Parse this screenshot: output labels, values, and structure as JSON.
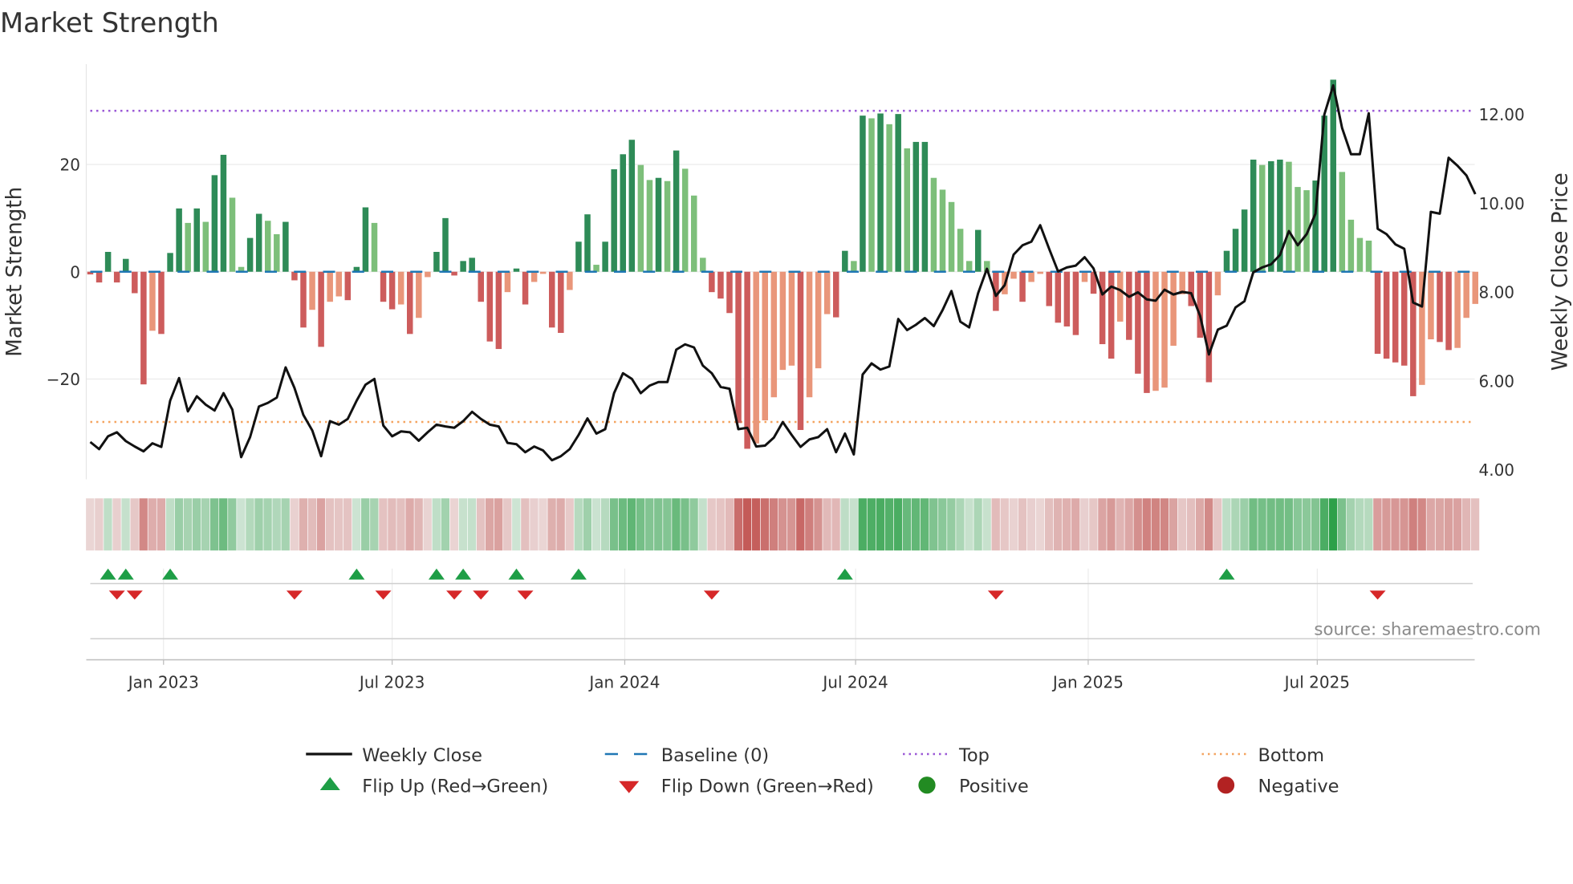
{
  "chart_data": {
    "type": "bar+line",
    "title": "Market Strength",
    "ylabel_left": "Market Strength",
    "ylabel_right": "Weekly Close Price",
    "left_ylim": [
      -38,
      39
    ],
    "right_ylim": [
      3.75,
      13.2
    ],
    "left_ticks": [
      {
        "v": 20,
        "label": "20"
      },
      {
        "v": 0,
        "label": "0"
      },
      {
        "v": -20,
        "label": "−20"
      }
    ],
    "right_ticks": [
      {
        "v": 12,
        "label": "12.00"
      },
      {
        "v": 10,
        "label": "10.00"
      },
      {
        "v": 8,
        "label": "8.00"
      },
      {
        "v": 6,
        "label": "6.00"
      },
      {
        "v": 4,
        "label": "4.00"
      }
    ],
    "x_unit": "week index (week 0 ≈ early Nov 2022)",
    "x_ticks": [
      {
        "label": "Jan 2023",
        "week": 8.25
      },
      {
        "label": "Jul 2023",
        "week": 34.0
      },
      {
        "label": "Jan 2024",
        "week": 60.2
      },
      {
        "label": "Jul 2024",
        "week": 86.2
      },
      {
        "label": "Jan 2025",
        "week": 112.4
      },
      {
        "label": "Jul 2025",
        "week": 138.2
      }
    ],
    "top_level": 30,
    "bottom_level": -28,
    "baseline": 0,
    "strength": [
      -0.5,
      -2,
      3.7,
      -2,
      2.4,
      -4,
      -21,
      -11,
      -11.6,
      3.5,
      11.8,
      9.1,
      11.8,
      9.3,
      18,
      21.8,
      13.8,
      0.9,
      6.3,
      10.8,
      9.5,
      7,
      9.3,
      -1.6,
      -10.4,
      -7.1,
      -14,
      -5.6,
      -4.6,
      -5.3,
      0.9,
      12,
      9.1,
      -5.6,
      -7,
      -6.1,
      -11.6,
      -8.6,
      -1,
      3.7,
      10,
      -0.7,
      2,
      2.6,
      -5.6,
      -13,
      -14.4,
      -3.8,
      0.6,
      -6.1,
      -1.9,
      -0.4,
      -10.4,
      -11.4,
      -3.4,
      5.6,
      10.7,
      1.3,
      5.6,
      19.1,
      21.9,
      24.6,
      19.9,
      17.1,
      17.5,
      16.9,
      22.6,
      19.2,
      14.2,
      2.6,
      -3.8,
      -5,
      -7.7,
      -28.2,
      -33,
      -32,
      -27.7,
      -23.4,
      -18.3,
      -17.5,
      -29.5,
      -23.4,
      -18,
      -7.9,
      -8.5,
      3.9,
      2,
      29.1,
      28.6,
      29.5,
      27.5,
      29.4,
      23,
      24.2,
      24.2,
      17.5,
      15.3,
      13,
      8,
      2,
      7.8,
      2,
      -7.3,
      -4.2,
      -1.3,
      -5.6,
      -1.9,
      -0.4,
      -6.4,
      -9.5,
      -10.2,
      -11.8,
      -1.9,
      -4.1,
      -13.5,
      -16.2,
      -9.3,
      -12.7,
      -19,
      -22.6,
      -22.2,
      -21.6,
      -13.8,
      -4.2,
      -6.4,
      -12.3,
      -20.6,
      -4.4,
      3.9,
      8,
      11.6,
      20.9,
      19.9,
      20.6,
      20.9,
      20.5,
      15.8,
      15.2,
      17,
      29.1,
      35.8,
      18.6,
      9.7,
      6.3,
      5.8,
      -15.3,
      -16.2,
      -16.9,
      -17.5,
      -23.2,
      -21.1,
      -12.6,
      -13.1,
      -14.6,
      -14.2,
      -8.6,
      -6
    ],
    "weekly_close": [
      4.6,
      4.44,
      4.73,
      4.82,
      4.62,
      4.5,
      4.39,
      4.57,
      4.49,
      5.53,
      6.04,
      5.29,
      5.63,
      5.44,
      5.31,
      5.7,
      5.33,
      4.26,
      4.71,
      5.4,
      5.48,
      5.6,
      6.28,
      5.82,
      5.21,
      4.86,
      4.28,
      5.07,
      4.99,
      5.12,
      5.53,
      5.89,
      6.02,
      4.97,
      4.73,
      4.84,
      4.82,
      4.63,
      4.82,
      4.99,
      4.95,
      4.92,
      5.07,
      5.28,
      5.12,
      4.99,
      4.95,
      4.58,
      4.55,
      4.37,
      4.5,
      4.41,
      4.19,
      4.28,
      4.44,
      4.76,
      5.13,
      4.79,
      4.89,
      5.7,
      6.15,
      6.02,
      5.7,
      5.87,
      5.95,
      5.95,
      6.68,
      6.8,
      6.73,
      6.32,
      6.15,
      5.84,
      5.8,
      4.89,
      4.92,
      4.5,
      4.52,
      4.7,
      5.05,
      4.76,
      4.49,
      4.66,
      4.71,
      4.89,
      4.37,
      4.79,
      4.32,
      6.12,
      6.37,
      6.23,
      6.3,
      7.37,
      7.12,
      7.24,
      7.39,
      7.21,
      7.57,
      8.0,
      7.31,
      7.18,
      7.95,
      8.5,
      7.89,
      8.13,
      8.82,
      9.03,
      9.11,
      9.48,
      8.95,
      8.44,
      8.53,
      8.57,
      8.76,
      8.51,
      7.92,
      8.1,
      8.02,
      7.87,
      7.97,
      7.81,
      7.78,
      8.03,
      7.92,
      7.98,
      7.95,
      7.44,
      6.57,
      7.13,
      7.22,
      7.63,
      7.77,
      8.42,
      8.53,
      8.6,
      8.81,
      9.35,
      9.03,
      9.28,
      9.74,
      11.97,
      12.63,
      11.67,
      11.08,
      11.08,
      12.0,
      9.4,
      9.28,
      9.05,
      8.95,
      7.74,
      7.65,
      9.78,
      9.74,
      11.0,
      10.82,
      10.6,
      10.18
    ],
    "legend": {
      "placement": "bottom",
      "items": [
        {
          "key": "close",
          "label": "Weekly Close"
        },
        {
          "key": "baseline",
          "label": "Baseline (0)"
        },
        {
          "key": "top",
          "label": "Top"
        },
        {
          "key": "bottom",
          "label": "Bottom"
        },
        {
          "key": "flipup",
          "label": "Flip Up (Red→Green)"
        },
        {
          "key": "flipdown",
          "label": "Flip Down (Green→Red)"
        },
        {
          "key": "positive",
          "label": "Positive"
        },
        {
          "key": "negative",
          "label": "Negative"
        }
      ]
    },
    "colors": {
      "pos_strong": "#2e8b57",
      "pos_weak": "#7dbf7a",
      "neg_strong": "#cd5c5c",
      "neg_weak": "#e9967a",
      "close": "#111111",
      "baseline": "#1f77b4",
      "top": "#9b59d6",
      "bottom": "#f4a460",
      "flipup": "#1e9e46",
      "flipdown": "#d62728",
      "positive": "#228b22",
      "negative": "#b22222",
      "heat_pos": "#2ca048",
      "heat_neg": "#c0504d",
      "grid": "#ebebeb"
    }
  },
  "source": "source: sharemaestro.com"
}
